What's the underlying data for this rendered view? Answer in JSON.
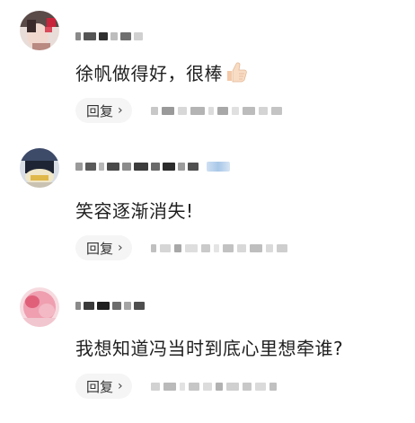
{
  "comments": [
    {
      "text": "徐帆做得好，很棒",
      "emoji": "thumbs-up-icon",
      "reply_label": "回复",
      "reply_chevron": "›"
    },
    {
      "text": "笑容逐渐消失!",
      "reply_label": "回复",
      "reply_chevron": "›"
    },
    {
      "text": "我想知道冯当时到底心里想牵谁?",
      "reply_label": "回复",
      "reply_chevron": "›"
    }
  ],
  "colors": {
    "reply_bg": "#f5f5f5",
    "text": "#1f1f1f",
    "blur_dark": "#4a4a4a",
    "blur_light": "#d6d6d6"
  }
}
